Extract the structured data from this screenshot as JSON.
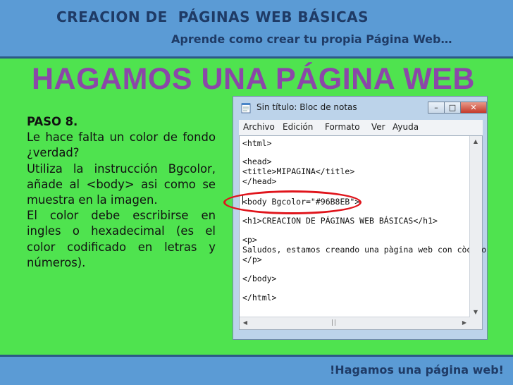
{
  "header": {
    "title": "CREACION DE  PÁGINAS WEB BÁSICAS",
    "subtitle": "Aprende como crear tu propia Página Web…"
  },
  "slide_title": "HAGAMOS UNA PÁGINA WEB",
  "instructions": {
    "step": "PASO 8.",
    "paragraphs": [
      "Le hace falta un color de fondo ¿verdad?",
      "Utiliza la instrucción Bgcolor, añade al <body> asi como se muestra en la imagen.",
      "El color debe escribirse en ingles o hexadecimal (es el color codificado en letras y números)."
    ]
  },
  "notepad": {
    "title": "Sin título: Bloc de notas",
    "controls": {
      "minimize": "–",
      "maximize": "□",
      "close": "✕"
    },
    "menu": [
      "Archivo",
      "Edición",
      "Formato",
      "Ver",
      "Ayuda"
    ],
    "lines": [
      "<html>",
      "<head>",
      "<title>MIPAGINA</title>",
      "</head>",
      "<body Bgcolor=\"#96B8EB\">",
      "<h1>CREACION DE PÁGINAS WEB BÁSICAS</h1>",
      "<p>",
      "Saludos, estamos creando una pàgina web con còdigo",
      "</p>",
      "</body>",
      "</html>"
    ]
  },
  "footer": "!Hagamos una página web!",
  "colors": {
    "background": "#4fe34f",
    "band": "#5b9bd5",
    "title_purple": "#8b47a8",
    "highlight_red": "#e0141b"
  }
}
